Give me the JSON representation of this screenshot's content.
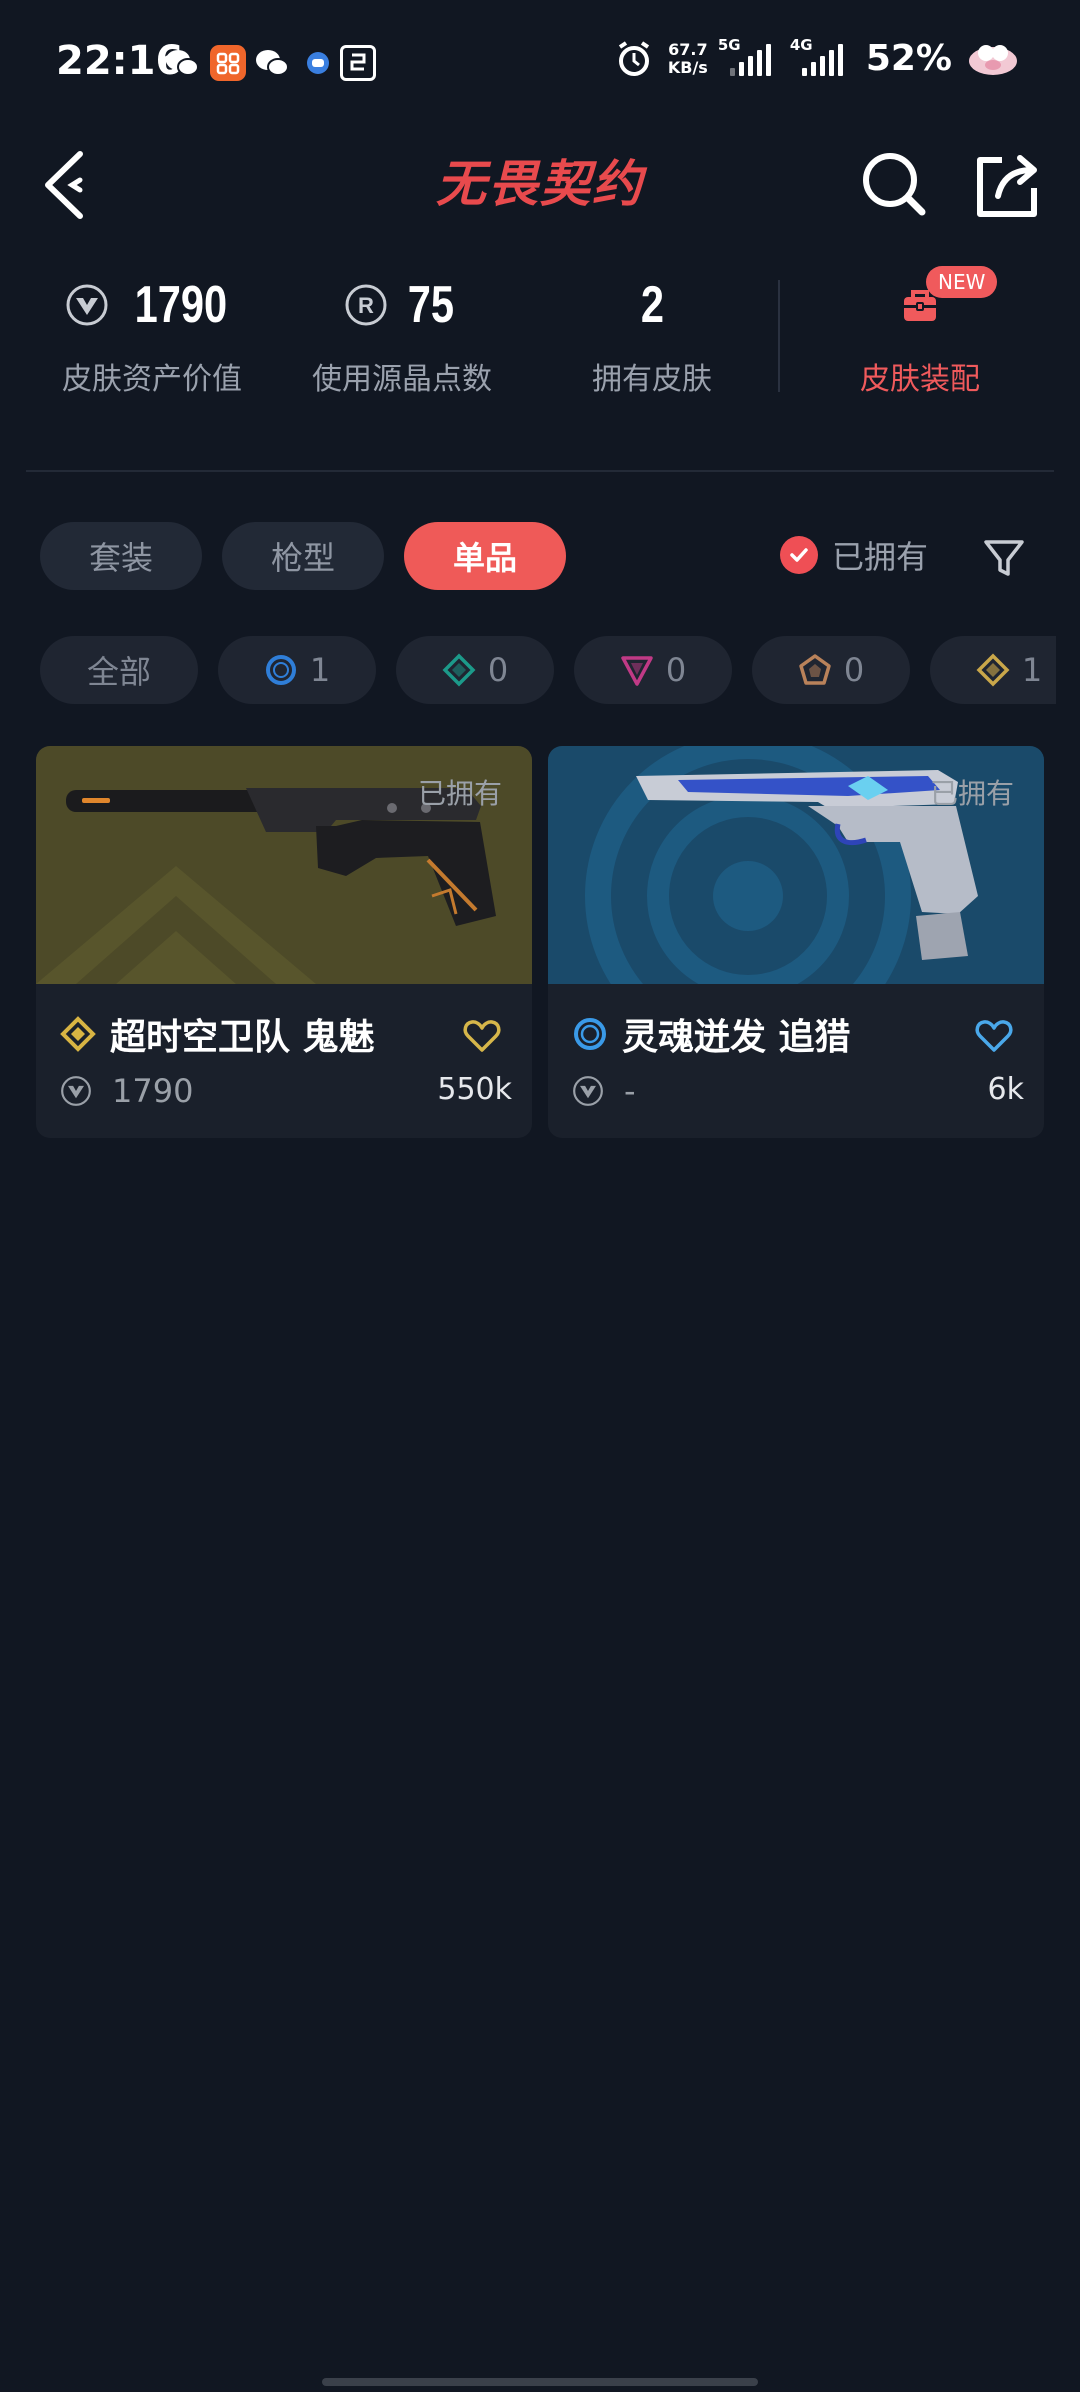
{
  "status_bar": {
    "time": "22:16",
    "net_speed_value": "67.7",
    "net_speed_unit": "KB/s",
    "signal_1_type": "5G",
    "signal_2_type": "4G",
    "battery": "52%"
  },
  "nav": {
    "logo_text": "无畏契约"
  },
  "stats": {
    "asset_value": "1790",
    "asset_label": "皮肤资产价值",
    "radianite_points": "75",
    "radianite_label": "使用源晶点数",
    "owned_count": "2",
    "owned_label": "拥有皮肤",
    "equip_label": "皮肤装配",
    "new_badge": "NEW"
  },
  "tabs": {
    "items": [
      "套装",
      "枪型",
      "单品"
    ],
    "active": "单品",
    "owned_filter_label": "已拥有"
  },
  "tiers": [
    {
      "label": "全部"
    },
    {
      "count": "1",
      "icon": "select-tier-circle-icon",
      "color": "#2f7ed8"
    },
    {
      "count": "0",
      "icon": "deluxe-tier-diamond-icon",
      "color": "#1c9a8a"
    },
    {
      "count": "0",
      "icon": "premium-tier-triangle-icon",
      "color": "#c03a86"
    },
    {
      "count": "0",
      "icon": "exclusive-tier-pentagon-icon",
      "color": "#b9825a"
    },
    {
      "count": "1",
      "icon": "ultra-tier-diamond-icon",
      "color": "#c9a74a"
    }
  ],
  "skins": [
    {
      "name": "超时空卫队 鬼魅",
      "owned_tag": "已拥有",
      "price": "1790",
      "likes": "550k",
      "tier_color": "#d8b443",
      "heart_color": "#d6b64a"
    },
    {
      "name": "灵魂迸发 追猎",
      "owned_tag": "已拥有",
      "price": "-",
      "likes": "6k",
      "tier_color": "#3a9ae8",
      "heart_color": "#4aa8ea"
    }
  ]
}
